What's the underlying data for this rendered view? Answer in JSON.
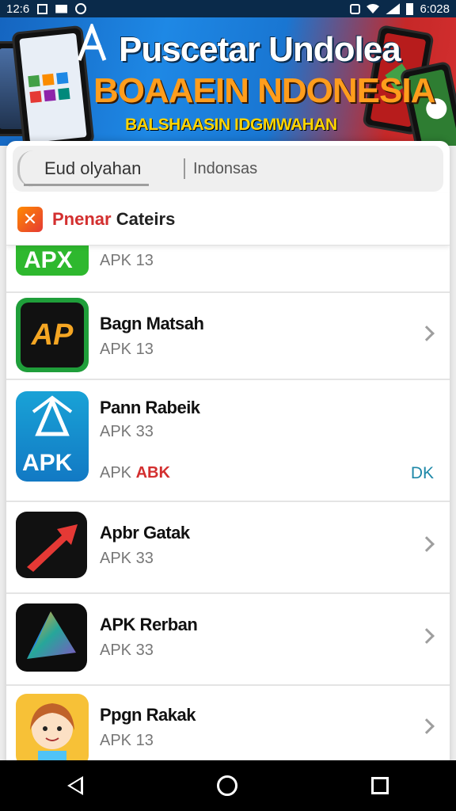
{
  "status_bar": {
    "time_left": "12:6",
    "time_right": "6:028"
  },
  "banner": {
    "title": "Puscetar Undolea",
    "subtitle": "BOAAEIN NDONESIA",
    "tagline": "BALSHAASIN IDGMWAHAN"
  },
  "search": {
    "left_label": "Eud olyahan",
    "right_label": "Indonsas"
  },
  "category": {
    "title_red": "Pnenar",
    "title_dark": "Cateirs"
  },
  "apps": [
    {
      "name": "",
      "version": "APK 13",
      "icon": "apk-green-icon"
    },
    {
      "name": "Bagn Matsah",
      "version": "APK 13",
      "icon": "ap-orange-icon"
    },
    {
      "name": "Pann Rabeik",
      "version": "APK 33",
      "extra_label": "APK",
      "extra_red": "ABK",
      "action": "DK",
      "icon": "apk-blue-icon"
    },
    {
      "name": "Apbr Gatak",
      "version": "APK 33",
      "icon": "red-arrow-icon"
    },
    {
      "name": "APK Rerban",
      "version": "APK 33",
      "icon": "triangle-gradient-icon"
    },
    {
      "name": "Ppgn Rakak",
      "version": "APK 13",
      "icon": "avatar-girl-icon"
    }
  ],
  "colors": {
    "accent_red": "#d32f2f",
    "action_teal": "#1e88a8",
    "banner_orange": "#ff9d1c",
    "banner_yellow": "#ffd400"
  }
}
